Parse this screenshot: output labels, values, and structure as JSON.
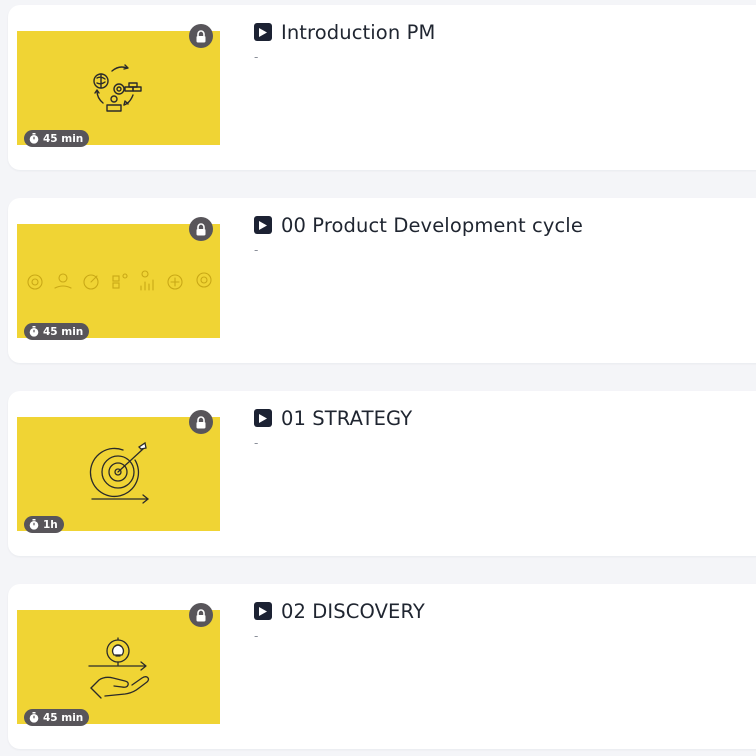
{
  "courses": [
    {
      "title": "Introduction PM",
      "description": "-",
      "duration": "45 min",
      "locked": true,
      "thumbnail_icon": "brain-cycle-icon"
    },
    {
      "title": "00 Product Development cycle",
      "description": "-",
      "duration": "45 min",
      "locked": true,
      "thumbnail_icon": "process-steps-icon"
    },
    {
      "title": "01 STRATEGY",
      "description": "-",
      "duration": "1h",
      "locked": true,
      "thumbnail_icon": "target-arrow-icon"
    },
    {
      "title": "02 DISCOVERY",
      "description": "-",
      "duration": "45 min",
      "locked": true,
      "thumbnail_icon": "lightbulb-hand-icon"
    }
  ],
  "colors": {
    "thumbnail_bg": "#f0d434",
    "badge_bg": "#58555a",
    "play_icon_bg": "#1c2233",
    "card_bg": "#ffffff",
    "page_bg": "#f4f5f8"
  }
}
